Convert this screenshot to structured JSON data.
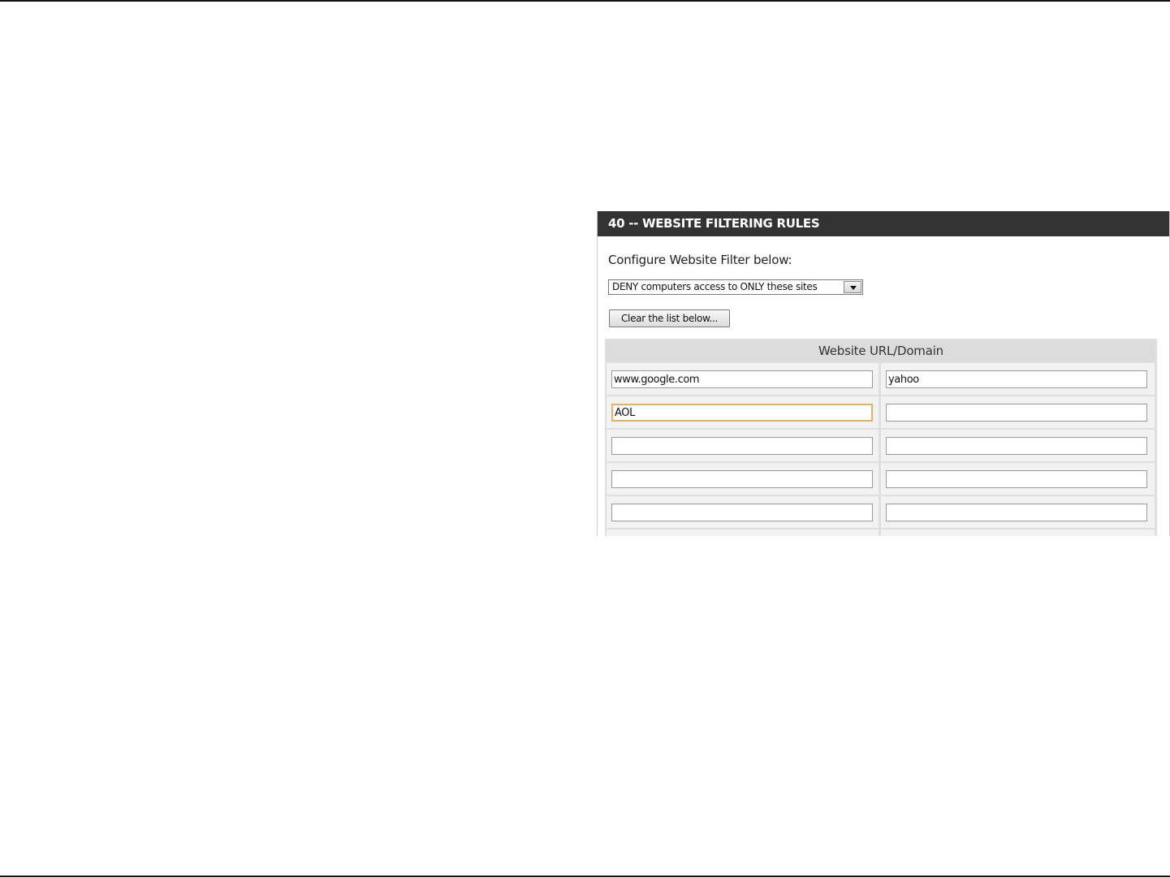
{
  "panel": {
    "header_title": "40 -- WEBSITE FILTERING RULES",
    "config_label": "Configure Website Filter below:",
    "filter_select": {
      "selected": "DENY computers access to ONLY these sites"
    },
    "clear_button_label": "Clear the list below...",
    "url_table": {
      "header": "Website URL/Domain",
      "rows": [
        [
          "www.google.com",
          "yahoo"
        ],
        [
          "AOL",
          ""
        ],
        [
          "",
          ""
        ],
        [
          "",
          ""
        ],
        [
          "",
          ""
        ],
        [
          "",
          ""
        ]
      ],
      "focused_field": "AOL"
    }
  },
  "colors": {
    "header_background": "#333333",
    "focus_border": "#e0b465",
    "table_background": "#dfdfdf"
  },
  "icons": {
    "select_arrow": "chevron-down-icon"
  }
}
